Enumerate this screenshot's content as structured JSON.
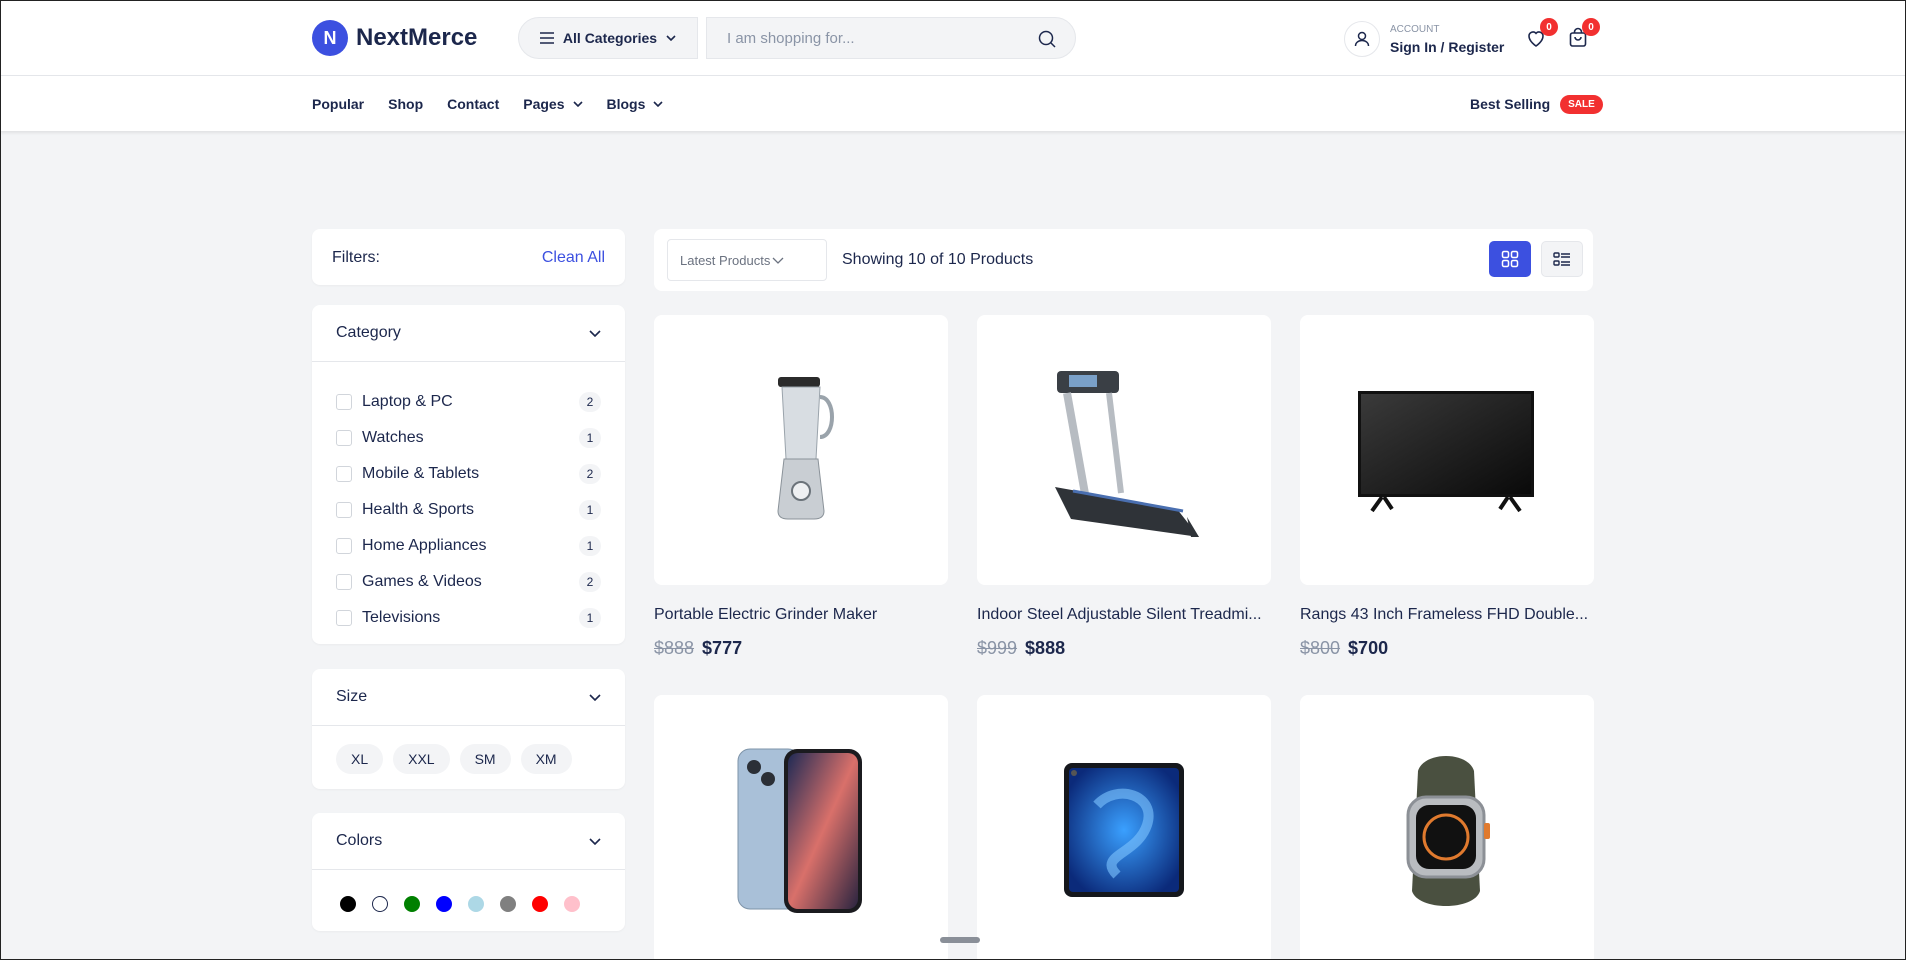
{
  "brand": {
    "name": "NextMerce",
    "mark": "N",
    "accent": "#3c50e0"
  },
  "header": {
    "category_button": "All Categories",
    "search_placeholder": "I am shopping for...",
    "account_kicker": "account",
    "account_link": "Sign In / Register",
    "wishlist_count": "0",
    "cart_count": "0"
  },
  "nav": {
    "items": [
      {
        "label": "Popular"
      },
      {
        "label": "Shop"
      },
      {
        "label": "Contact"
      },
      {
        "label": "Pages"
      },
      {
        "label": "Blogs"
      }
    ],
    "best_selling": "Best Selling",
    "sale_badge": "SALE"
  },
  "filters": {
    "label": "Filters:",
    "clean_all": "Clean All",
    "category": {
      "title": "Category",
      "items": [
        {
          "label": "Laptop & PC",
          "count": "2"
        },
        {
          "label": "Watches",
          "count": "1"
        },
        {
          "label": "Mobile & Tablets",
          "count": "2"
        },
        {
          "label": "Health & Sports",
          "count": "1"
        },
        {
          "label": "Home Appliances",
          "count": "1"
        },
        {
          "label": "Games & Videos",
          "count": "2"
        },
        {
          "label": "Televisions",
          "count": "1"
        }
      ]
    },
    "size": {
      "title": "Size",
      "options": [
        "XL",
        "XXL",
        "SM",
        "XM"
      ]
    },
    "colors": {
      "title": "Colors",
      "swatches": [
        "#000000",
        "#ffffff",
        "#008000",
        "#0000ff",
        "#add8e6",
        "#808080",
        "#ff0000",
        "#ffc0cb"
      ]
    }
  },
  "toolbar": {
    "sort_value": "Latest Products",
    "showing": "Showing 10 of 10 Products"
  },
  "products": [
    {
      "title": "Portable Electric Grinder Maker",
      "old_price": "$888",
      "price": "$777"
    },
    {
      "title": "Indoor Steel Adjustable Silent Treadmi...",
      "old_price": "$999",
      "price": "$888"
    },
    {
      "title": "Rangs 43 Inch Frameless FHD Double...",
      "old_price": "$800",
      "price": "$700"
    },
    {
      "title": "",
      "old_price": "",
      "price": ""
    },
    {
      "title": "",
      "old_price": "",
      "price": ""
    },
    {
      "title": "",
      "old_price": "",
      "price": ""
    }
  ]
}
